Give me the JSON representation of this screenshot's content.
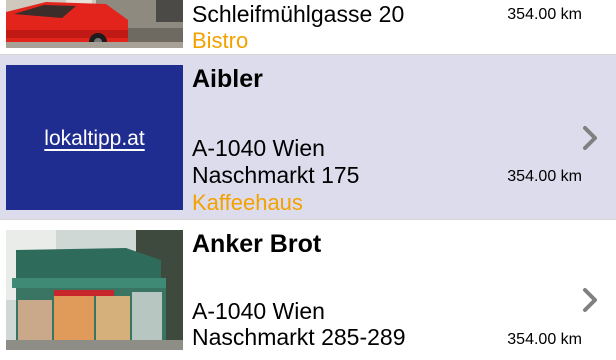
{
  "list": {
    "items": [
      {
        "name": "",
        "address_line1": "Schleifmühlgasse 20",
        "category": "Bistro",
        "distance": "354.00 km",
        "thumb": "street-photo-red-car"
      },
      {
        "name": "Aibler",
        "address_line1": "A-1040 Wien",
        "address_line2": "Naschmarkt 175",
        "category": "Kaffeehaus",
        "distance": "354.00 km",
        "thumb": "lokaltipp-logo",
        "logo_text": "lokaltipp.at",
        "selected": true
      },
      {
        "name": "Anker Brot",
        "address_line1": "A-1040 Wien",
        "address_line2": "Naschmarkt 285-289",
        "distance": "354.00 km",
        "thumb": "bakery-kiosk-photo"
      }
    ]
  },
  "icons": {
    "chevron": "chevron-right-icon"
  },
  "colors": {
    "category": "#f4a100",
    "highlight_row": "#dcdcec",
    "logo_bg": "#1e2d8f"
  }
}
